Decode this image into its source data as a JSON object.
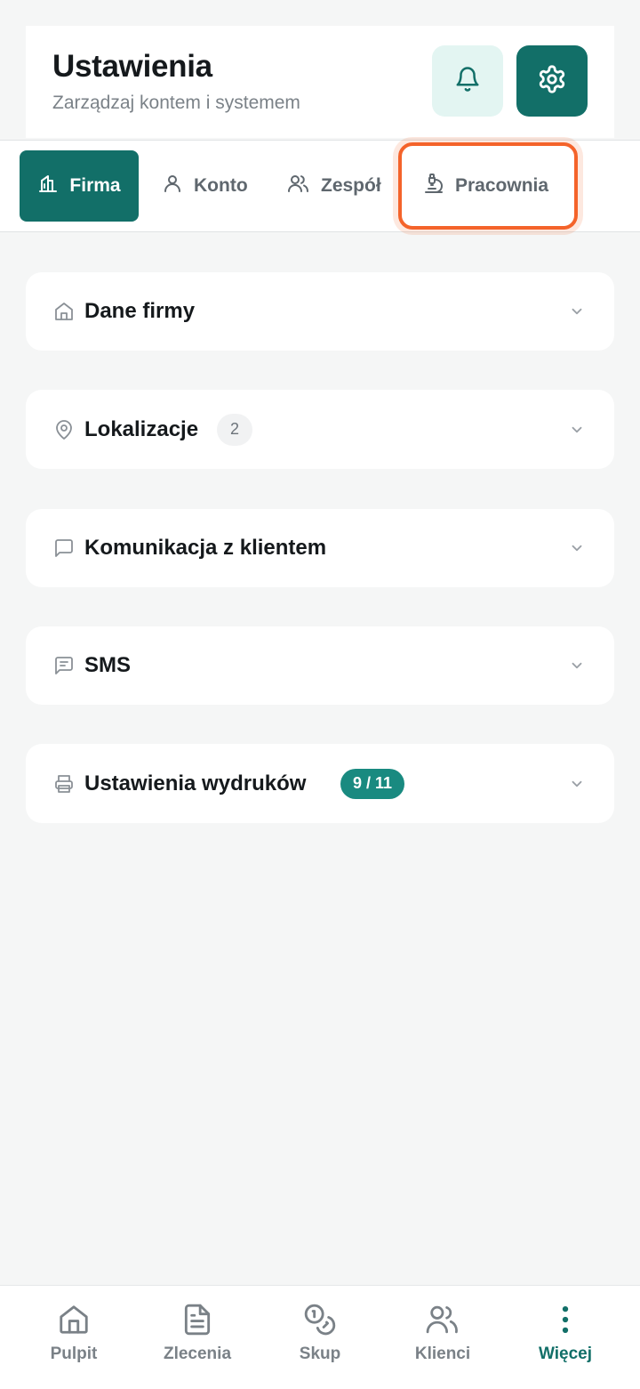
{
  "header": {
    "title": "Ustawienia",
    "subtitle": "Zarządzaj kontem i systemem",
    "bell_icon": "bell-icon",
    "gear_icon": "gear-icon"
  },
  "tabs": [
    {
      "label": "Firma",
      "icon": "building-icon",
      "active": true
    },
    {
      "label": "Konto",
      "icon": "user-icon",
      "active": false
    },
    {
      "label": "Zespół",
      "icon": "users-icon",
      "active": false
    },
    {
      "label": "Pracownia",
      "icon": "microscope-icon",
      "active": false,
      "highlighted": true
    }
  ],
  "sections": [
    {
      "title": "Dane firmy",
      "icon": "home-icon"
    },
    {
      "title": "Lokalizacje",
      "icon": "map-pin-icon",
      "badge": "2"
    },
    {
      "title": "Komunikacja z klientem",
      "icon": "message-square-icon"
    },
    {
      "title": "SMS",
      "icon": "message-text-icon"
    },
    {
      "title": "Ustawienia wydruków",
      "icon": "printer-icon",
      "badge": "9 / 11"
    }
  ],
  "bottom_nav": [
    {
      "label": "Pulpit",
      "icon": "home-icon"
    },
    {
      "label": "Zlecenia",
      "icon": "document-icon"
    },
    {
      "label": "Skup",
      "icon": "coins-icon"
    },
    {
      "label": "Klienci",
      "icon": "users-icon"
    },
    {
      "label": "Więcej",
      "icon": "more-vertical-icon",
      "active": true
    }
  ],
  "colors": {
    "accent": "#126f68",
    "accent_light": "#e3f5f2",
    "highlight": "#f4632a",
    "background": "#f5f6f6"
  }
}
